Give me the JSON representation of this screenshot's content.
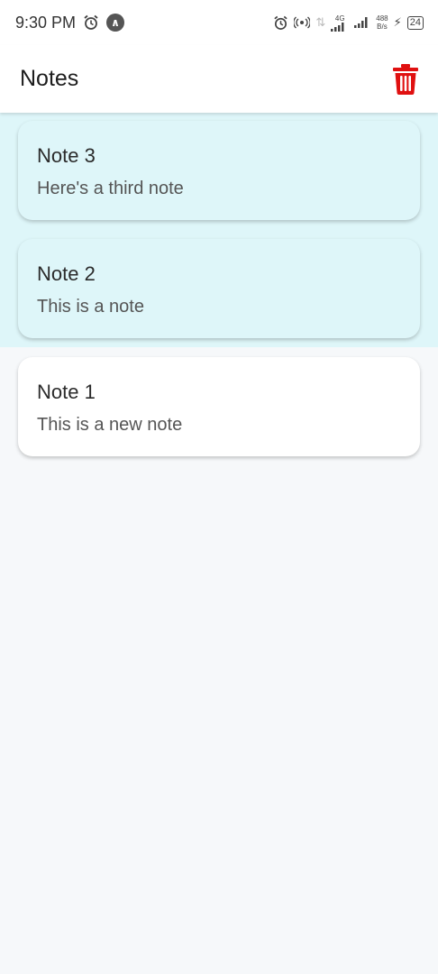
{
  "status_bar": {
    "time": "9:30 PM",
    "network_type": "4G",
    "data_rate_value": "488",
    "data_rate_unit": "B/s",
    "battery": "24"
  },
  "app_bar": {
    "title": "Notes",
    "delete_icon": "trash-icon",
    "accent_color": "#e01010"
  },
  "notes": [
    {
      "title": "Note 3",
      "body": "Here's a third note",
      "selected": true
    },
    {
      "title": "Note 2",
      "body": "This is a note",
      "selected": true
    },
    {
      "title": "Note 1",
      "body": "This is a new note",
      "selected": false
    }
  ],
  "colors": {
    "selected_background": "#def6f9",
    "page_background": "#f6f8fa"
  }
}
